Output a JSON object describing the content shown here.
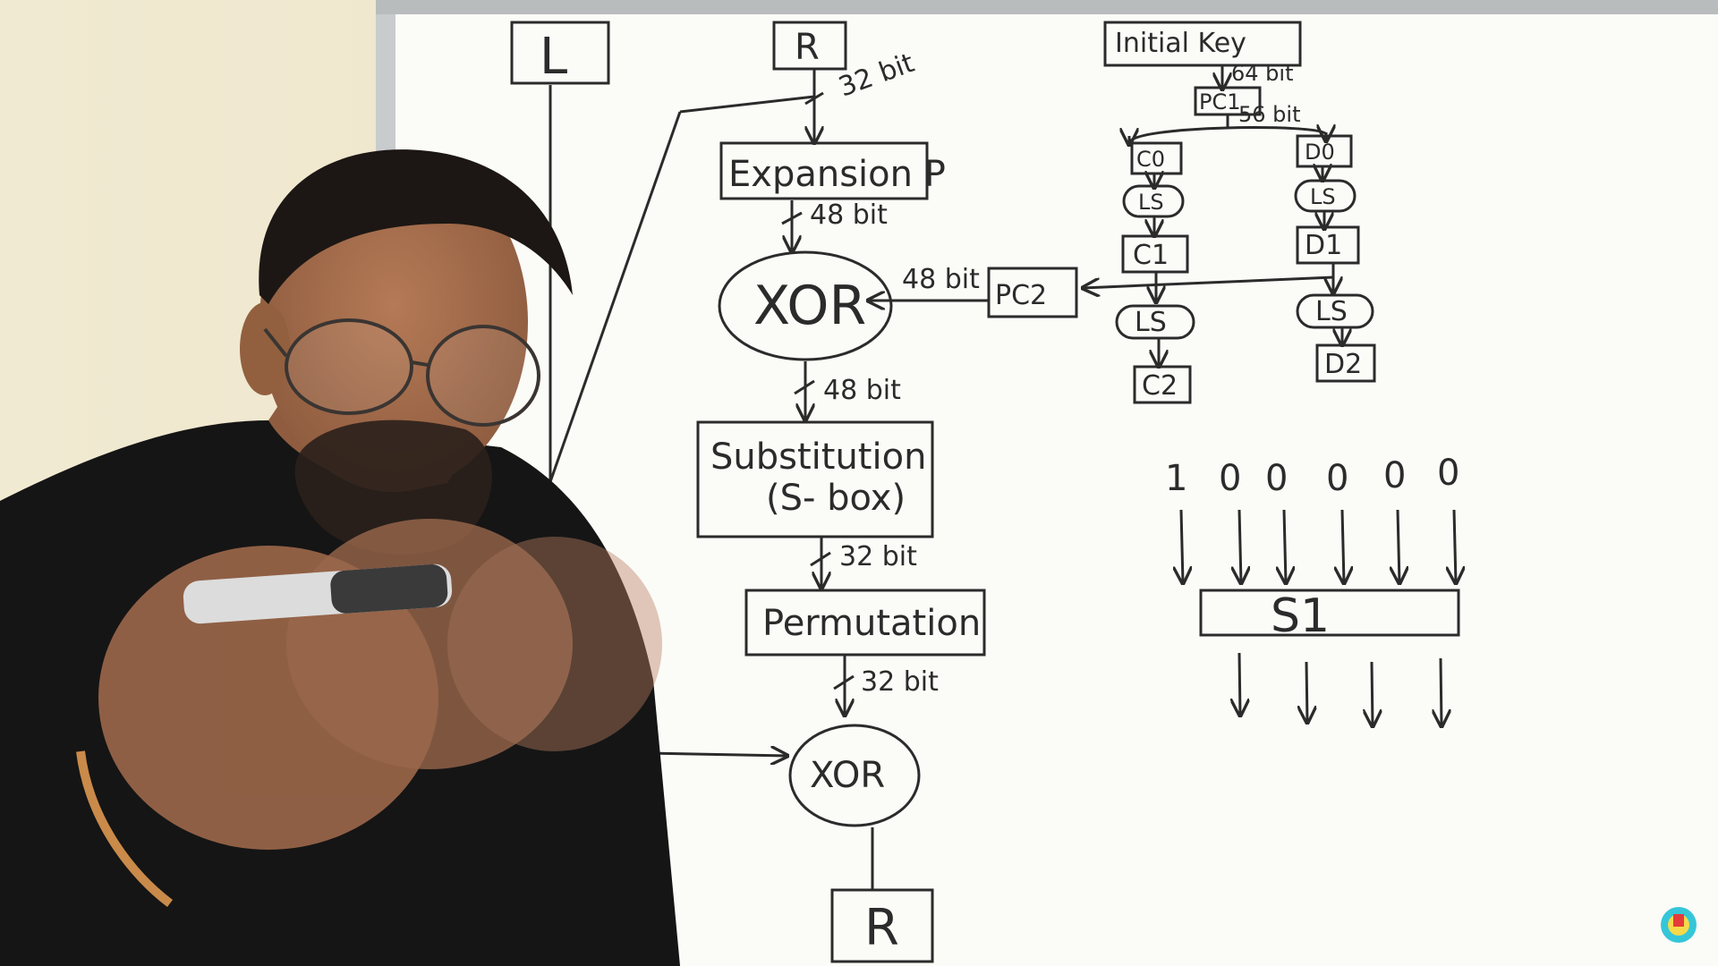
{
  "whiteboard": {
    "left_box": "L",
    "right_box_top": "R",
    "right_box_bottom": "R",
    "label_32bit_top": "32 bit",
    "expansion": "Expansion P",
    "label_48bit_a": "48 bit",
    "xor_top": "XOR",
    "label_48bit_b": "48 bit",
    "label_48bit_c": "48 bit",
    "pc2": "PC2",
    "substitution_line1": "Substitution",
    "substitution_line2": "(S- box)",
    "label_32bit_b": "32 bit",
    "permutation": "Permutation",
    "label_32bit_c": "32 bit",
    "xor_bottom": "XOR",
    "initial_key": "Initial Key",
    "label_64bit": "64 bit",
    "pc1": "PC1",
    "label_56bit": "56 bit",
    "c0": "C0",
    "d0": "D0",
    "ls": "LS",
    "c1": "C1",
    "d1": "D1",
    "c2": "C2",
    "d2": "D2",
    "sbox_bits": [
      "1",
      "0",
      "0",
      "0",
      "0",
      "0"
    ],
    "sbox_name": "S1"
  },
  "colors": {
    "wall": "#f3ecd6",
    "board": "#fbfbf8",
    "ink": "#2b2b2b",
    "shirt": "#151515",
    "skin": "#a86e4e"
  },
  "logo": {
    "icon": "channel-logo-icon"
  }
}
